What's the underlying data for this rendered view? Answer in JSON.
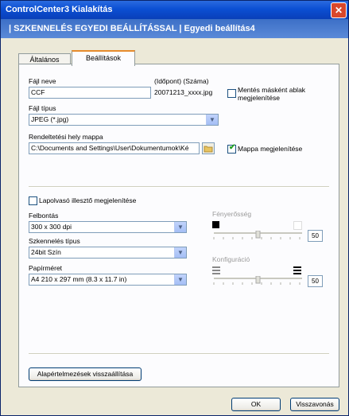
{
  "window": {
    "title": "ControlCenter3 Kialakítás",
    "close_glyph": "✕"
  },
  "banner": {
    "text": "| SZKENNELÉS EGYEDI BEÁLLÍTÁSSAL | Egyedi beállítás4"
  },
  "tabs": [
    {
      "label": "Általános"
    },
    {
      "label": "Beállítások"
    }
  ],
  "file_name": {
    "label": "Fájl neve",
    "value": "CCF",
    "datetime_label": "(Időpont) (Száma)",
    "datetime_value": "20071213_xxxx.jpg"
  },
  "save_as_dialog": {
    "label": "Mentés másként ablak megjelenítése",
    "checked": false
  },
  "file_type": {
    "label": "Fájl típus",
    "value": "JPEG (*.jpg)"
  },
  "destination": {
    "label": "Rendeltetési hely mappa",
    "value": "C:\\Documents and Settings\\User\\Dokumentumok\\Ké"
  },
  "show_folder": {
    "label": "Mappa megjelenítése",
    "checked": true
  },
  "scanner_interface": {
    "label": "Lapolvasó illesztő megjelenítése",
    "checked": false
  },
  "resolution": {
    "label": "Felbontás",
    "value": "300 x 300 dpi"
  },
  "scan_type": {
    "label": "Szkennelés típus",
    "value": "24bit Szín"
  },
  "paper_size": {
    "label": "Papírméret",
    "value": "A4 210 x 297 mm (8.3 x 11.7 in)"
  },
  "brightness": {
    "label": "Fényerősség",
    "value": "50"
  },
  "contrast": {
    "label": "Konfiguráció",
    "value": "50"
  },
  "buttons": {
    "restore_defaults": "Alapértelmezések visszaállítása",
    "ok": "OK",
    "cancel": "Visszavonás"
  },
  "colors": {
    "title_bar": "#0b4fd3",
    "banner": "#3c6fc7",
    "tab_highlight": "#e68b2c",
    "window_bg": "#ece9d8"
  }
}
